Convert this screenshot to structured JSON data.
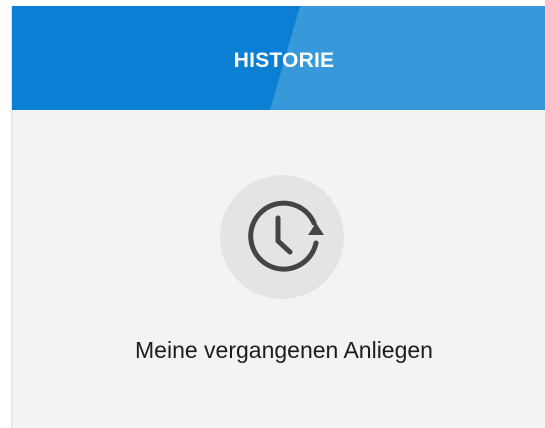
{
  "card": {
    "header_title": "HISTORIE",
    "icon": "history-icon",
    "label": "Meine vergangenen Anliegen"
  },
  "colors": {
    "header_dark": "#0a7fd4",
    "header_light": "#3799d9",
    "card_background": "#f3f3f3",
    "icon_circle": "#e4e4e4",
    "icon_stroke": "#444444"
  }
}
